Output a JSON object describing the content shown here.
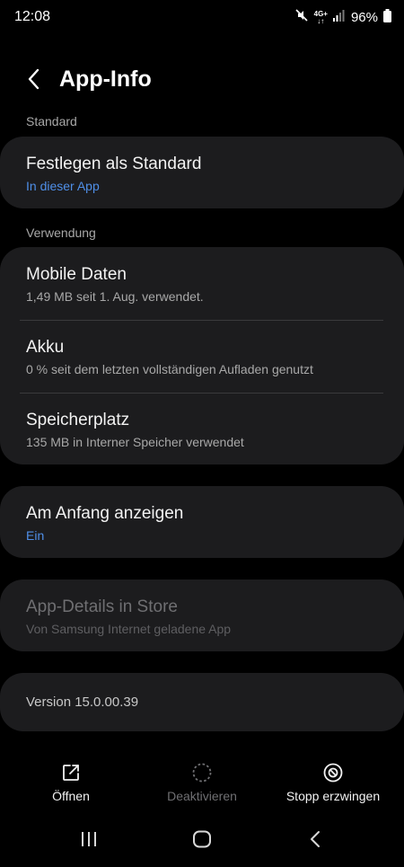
{
  "status_bar": {
    "time": "12:08",
    "network_top": "4G+",
    "network_bottom": "↓↑",
    "battery": "96%"
  },
  "header": {
    "title": "App-Info",
    "back_icon": "chevron-left-icon"
  },
  "sections": {
    "standard_label": "Standard",
    "usage_label": "Verwendung"
  },
  "standard_card": {
    "title": "Festlegen als Standard",
    "subtitle": "In dieser App"
  },
  "usage_card": {
    "items": [
      {
        "title": "Mobile Daten",
        "subtitle": "1,49 MB seit 1. Aug. verwendet."
      },
      {
        "title": "Akku",
        "subtitle": "0 % seit dem letzten vollständigen Aufladen genutzt"
      },
      {
        "title": "Speicherplatz",
        "subtitle": "135 MB in Interner Speicher verwendet"
      }
    ]
  },
  "top_card": {
    "title": "Am Anfang anzeigen",
    "subtitle": "Ein"
  },
  "store_card": {
    "title": "App-Details in Store",
    "subtitle": "Von Samsung Internet geladene App"
  },
  "version_card": {
    "text": "Version 15.0.00.39"
  },
  "actions": {
    "open": {
      "label": "Öffnen",
      "icon": "open-external-icon"
    },
    "deactivate": {
      "label": "Deaktivieren",
      "icon": "deactivate-icon"
    },
    "force_stop": {
      "label": "Stopp erzwingen",
      "icon": "block-icon"
    }
  },
  "colors": {
    "background": "#000000",
    "card": "#1c1c1e",
    "accent_blue": "#4f8fe8",
    "secondary_text": "#a8a8a8"
  }
}
